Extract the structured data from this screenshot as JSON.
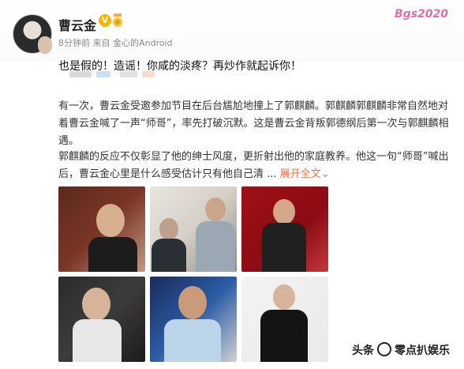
{
  "post": {
    "username": "曹云金",
    "meta": "8分钟前 来自 金心的Android",
    "status": "也是假的！造谣！你咸的淡疼？再炒作就起诉你！",
    "paragraph1": "有一次，曹云金受邀参加节目在后台尴尬地撞上了郭麒麟。郭麒麟郭麒麟非常自然地对着曹云金喊了一声“师哥”，率先打破沉默。这是曹云金背叛郭德纲后第一次与郭麒麟相遇。",
    "paragraph2": "郭麒麟的反应不仅彰显了他的绅士风度，更折射出他的家庭教养。他这一句“师哥”喊出后，曹云金心里是什么感受估计只有他自己清 ...",
    "expand_label": "展开全文",
    "expand_arrow": "⌄"
  },
  "watermarks": {
    "top": "Bgs2020",
    "bottom_left": "头条",
    "bottom_right": "零点扒娱乐"
  },
  "colors": {
    "accent": "#eb7350",
    "username": "#222222",
    "meta": "#8a8a8a"
  }
}
